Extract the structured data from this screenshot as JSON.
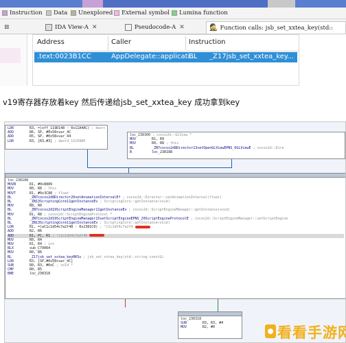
{
  "top_legend": [
    {
      "label": "Instruction",
      "color": "#c6a0d6"
    },
    {
      "label": "Data",
      "color": "#c8c8c8"
    },
    {
      "label": "Unexplored",
      "color": "#b5b39a"
    },
    {
      "label": "External symbol",
      "color": "#f7b7e6"
    },
    {
      "label": "Lumina function",
      "color": "#7fd47f"
    }
  ],
  "tabs": [
    {
      "label": "IDA View-A",
      "icon": "ida-view-icon",
      "active": false
    },
    {
      "label": "Pseudocode-A",
      "icon": "pseudocode-icon",
      "active": false
    },
    {
      "label": "Function calls: jsb_set_xxtea_key(std::",
      "icon": "function-calls-icon",
      "active": true
    }
  ],
  "xrefs": {
    "headers": {
      "address": "Address",
      "caller": "Caller",
      "instruction": "Instruction"
    },
    "rows": [
      {
        "address": ".text:0023B1CC",
        "caller": "AppDelegate::applicati...",
        "mnemonic": "BL",
        "operand": "_Z17jsb_set_xxtea_key..."
      }
    ]
  },
  "caption": "v19寄存器存放着key 然后传递给jsb_set_xxtea_key 成功拿到key",
  "graph": {
    "block_top_left": [
      {
        "m": "LDR",
        "o": "R3, =(off_119D148 - 0x11A4AC)",
        "c": "; dword_11C6980"
      },
      {
        "m": "ADD",
        "o": "R6, SP, #0x58+var_4C",
        "c": ""
      },
      {
        "m": "ADD",
        "o": "R5, SP, #0x58+var_44",
        "c": ""
      },
      {
        "m": "LDR",
        "o": "R3, [R3,#3]",
        "c": "; dword_11C6980"
      }
    ],
    "block_top_right": [
      {
        "m": "loc_238300",
        "o": "",
        "c": "; cocos2d::GLView *"
      },
      {
        "m": "MOV",
        "o": "R1, R9",
        "c": ""
      },
      {
        "m": "MOV",
        "o": "R0, R8",
        "c": "; this"
      },
      {
        "m": "BL",
        "o": "_ZN7cocos2d8Director13setOpenGLViewEPNS_6GLViewE",
        "c": "; cocos2d::Dire"
      },
      {
        "m": "B",
        "o": "loc_238188",
        "c": ""
      }
    ],
    "block_main": [
      {
        "m": "loc_238188",
        "o": "",
        "c": ""
      },
      {
        "m": "MOVW",
        "o": "R1, #0x8889",
        "c": ""
      },
      {
        "m": "MOV",
        "o": "R0, R8",
        "c": "; this"
      },
      {
        "m": "MOVT",
        "o": "R1, #0x3C88",
        "c": "; float"
      },
      {
        "m": "BL",
        "o": "_ZN7cocos2d8Director20setAnimationIntervalEf",
        "c": "; cocos2d::Director::setAnimationInterval(float)"
      },
      {
        "m": "BL",
        "o": "_ZN13ScriptingCore11getInstanceEv",
        "c": "; ScriptingCore::getInstance(void)"
      },
      {
        "m": "MOV",
        "o": "R8, R0",
        "c": ""
      },
      {
        "m": "BL",
        "o": "_ZN7cocos2d19ScriptEngineManager11getInstanceEv",
        "c": "; cocos2d::ScriptEngineManager::getInstance(void)"
      },
      {
        "m": "MOV",
        "o": "R1, R8",
        "c": "; cocos2d::ScriptEngineProtocol *"
      },
      {
        "m": "BL",
        "o": "_ZN7cocos2d19ScriptEngineManager15setScriptEngineEPNS_20ScriptEngineProtocolE",
        "c": "; cocos2d::ScriptEngineManager::setScriptEngine"
      },
      {
        "m": "BL",
        "o": "_ZN13ScriptingCore11getInstanceEv",
        "c": "; ScriptingCore::getInstance(void)"
      },
      {
        "m": "LDR",
        "o": "R1, =(aC1c1d54c7a2f48 - 0x2381C0)",
        "c": "; \"c1c1d54c7a2f4"
      },
      {
        "m": "ADD",
        "o": "R2, R6",
        "c": ""
      },
      {
        "m": "ADD",
        "o": "R1, PC, R1",
        "c": "; \"c1c1d54c7a2f48"
      },
      {
        "m": "MOV",
        "o": "R0, R4",
        "c": ""
      },
      {
        "m": "MOV",
        "o": "R1, R4",
        "c": "; int"
      },
      {
        "m": "BLX",
        "o": "sub_C79064",
        "c": ""
      },
      {
        "m": "MOV",
        "o": "R0, R6",
        "c": ""
      },
      {
        "m": "BL",
        "o": "_Z17jsb_set_xxtea_keyRKSs",
        "c": "; jsb_set_xxtea_key(std::string const&)"
      },
      {
        "m": "LDR",
        "o": "R3, [SP,#0x58+var_4C]",
        "c": ""
      },
      {
        "m": "SUB",
        "o": "R0, R3, #0xC",
        "c": "; void *"
      },
      {
        "m": "CMP",
        "o": "R0, R5",
        "c": ""
      },
      {
        "m": "BNE",
        "o": "loc_238318",
        "c": ""
      }
    ],
    "block_bottom": [
      {
        "m": "loc_238318",
        "o": "",
        "c": ""
      },
      {
        "m": "SUB",
        "o": "R3, R3, #4",
        "c": ""
      },
      {
        "m": "MOV",
        "o": "R2, #0",
        "c": ""
      }
    ]
  },
  "watermark": "看看手游网",
  "colors": {
    "selection": "#2f8fd6",
    "graph_bg": "#f0f4fa",
    "block_header": "#bcc8d8",
    "watermark": "#f2b01e"
  }
}
